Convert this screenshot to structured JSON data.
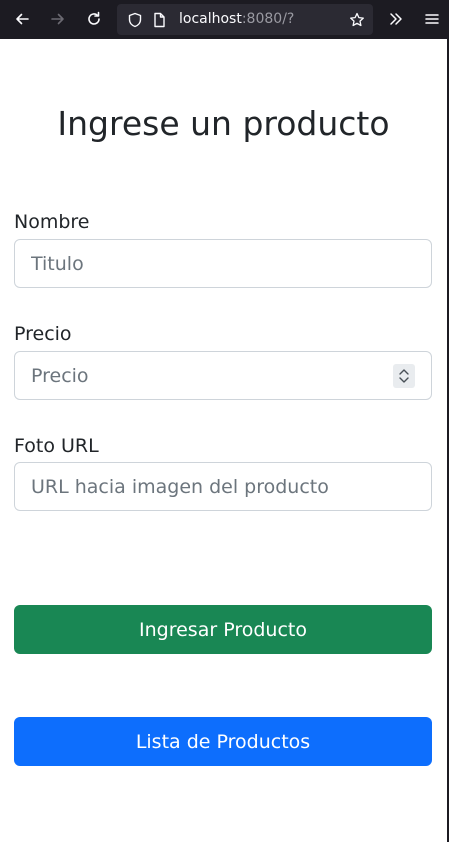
{
  "browser": {
    "url_host": "localhost",
    "url_rest": ":8080/?",
    "icons": [
      "back-arrow-icon",
      "forward-arrow-icon",
      "reload-icon",
      "shield-icon",
      "page-icon",
      "star-icon",
      "overflow-chevrons-icon",
      "hamburger-menu-icon"
    ]
  },
  "form": {
    "title": "Ingrese un producto",
    "nombre": {
      "label": "Nombre",
      "placeholder": "Titulo",
      "value": ""
    },
    "precio": {
      "label": "Precio",
      "placeholder": "Precio",
      "value": ""
    },
    "foto": {
      "label": "Foto URL",
      "placeholder": "URL hacia imagen del producto",
      "value": ""
    },
    "submit_label": "Ingresar Producto",
    "list_label": "Lista de Productos"
  },
  "colors": {
    "success": "#198754",
    "primary": "#0d6efd",
    "toolbar": "#1c1b22"
  }
}
